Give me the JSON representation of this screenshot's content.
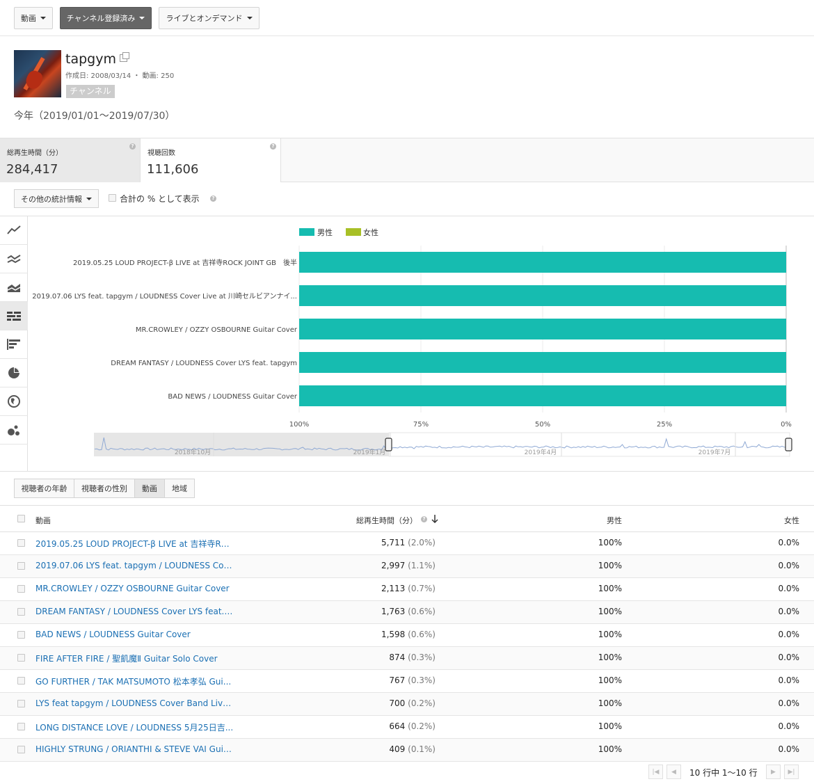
{
  "filters": {
    "video_label": "動画",
    "subscribed_label": "チャンネル登録済み",
    "live_label": "ライブとオンデマンド"
  },
  "channel": {
    "name": "tapgym",
    "meta": "作成日: 2008/03/14 ・ 動画: 250",
    "badge": "チャンネル"
  },
  "period": "今年（2019/01/01～2019/07/30）",
  "metrics": [
    {
      "label": "総再生時間（分）",
      "value": "284,417"
    },
    {
      "label": "視聴回数",
      "value": "111,606"
    }
  ],
  "options": {
    "more_stats_label": "その他の統計情報",
    "percent_label": "合計の % として表示"
  },
  "colors": {
    "male": "#16bcb0",
    "female": "#a8c026",
    "link": "#1a6fb3"
  },
  "rail_icons": [
    "line-chart-icon",
    "multi-line-icon",
    "stacked-area-icon",
    "stacked-bar-icon",
    "bar-chart-icon",
    "pie-chart-icon",
    "globe-icon",
    "bubble-icon"
  ],
  "chart_data": {
    "type": "bar",
    "categories": [
      "2019.05.25 LOUD PROJECT-β LIVE at 吉祥寺ROCK JOINT GB　後半",
      "2019.07.06 LYS feat. tapgym / LOUDNESS Cover Live at 川崎セルビアンナイ...",
      "MR.CROWLEY / OZZY OSBOURNE Guitar Cover",
      "DREAM FANTASY / LOUDNESS Cover LYS feat. tapgym",
      "BAD NEWS / LOUDNESS Guitar Cover"
    ],
    "series": [
      {
        "name": "男性",
        "values": [
          100,
          100,
          100,
          100,
          100
        ]
      },
      {
        "name": "女性",
        "values": [
          0,
          0,
          0,
          0,
          0
        ]
      }
    ],
    "x_ticks": [
      "100%",
      "75%",
      "50%",
      "25%",
      "0%"
    ],
    "xlim": [
      100,
      0
    ],
    "legend": "top-center",
    "grid": true
  },
  "timeline": {
    "labels": [
      "2018年10月",
      "2019年1月",
      "2019年4月",
      "2019年7月"
    ]
  },
  "tabs": [
    "視聴者の年齢",
    "視聴者の性別",
    "動画",
    "地域"
  ],
  "table": {
    "headers": {
      "video": "動画",
      "watch_time": "総再生時間（分）",
      "male": "男性",
      "female": "女性"
    },
    "rows": [
      {
        "title": "2019.05.25 LOUD PROJECT-β LIVE at 吉祥寺RO...",
        "time": "5,711",
        "pct": "(2.0%)",
        "male": "100%",
        "female": "0.0%"
      },
      {
        "title": "2019.07.06 LYS feat. tapgym / LOUDNESS Cove...",
        "time": "2,997",
        "pct": "(1.1%)",
        "male": "100%",
        "female": "0.0%"
      },
      {
        "title": "MR.CROWLEY / OZZY OSBOURNE Guitar Cover",
        "time": "2,113",
        "pct": "(0.7%)",
        "male": "100%",
        "female": "0.0%"
      },
      {
        "title": "DREAM FANTASY / LOUDNESS Cover LYS feat. t...",
        "time": "1,763",
        "pct": "(0.6%)",
        "male": "100%",
        "female": "0.0%"
      },
      {
        "title": "BAD NEWS / LOUDNESS Guitar Cover",
        "time": "1,598",
        "pct": "(0.6%)",
        "male": "100%",
        "female": "0.0%"
      },
      {
        "title": "FIRE AFTER FIRE / 聖飢魔Ⅱ Guitar Solo Cover",
        "time": "874",
        "pct": "(0.3%)",
        "male": "100%",
        "female": "0.0%"
      },
      {
        "title": "GO FURTHER / TAK MATSUMOTO 松本孝弘 Gui...",
        "time": "767",
        "pct": "(0.3%)",
        "male": "100%",
        "female": "0.0%"
      },
      {
        "title": "LYS feat tapgym / LOUDNESS Cover Band Live ...",
        "time": "700",
        "pct": "(0.2%)",
        "male": "100%",
        "female": "0.0%"
      },
      {
        "title": "LONG DISTANCE LOVE / LOUDNESS 5月25日吉...",
        "time": "664",
        "pct": "(0.2%)",
        "male": "100%",
        "female": "0.0%"
      },
      {
        "title": "HIGHLY STRUNG / ORIANTHI & STEVE VAI Guit...",
        "time": "409",
        "pct": "(0.1%)",
        "male": "100%",
        "female": "0.0%"
      }
    ]
  },
  "pager": {
    "info": "10 行中 1～10 行"
  }
}
